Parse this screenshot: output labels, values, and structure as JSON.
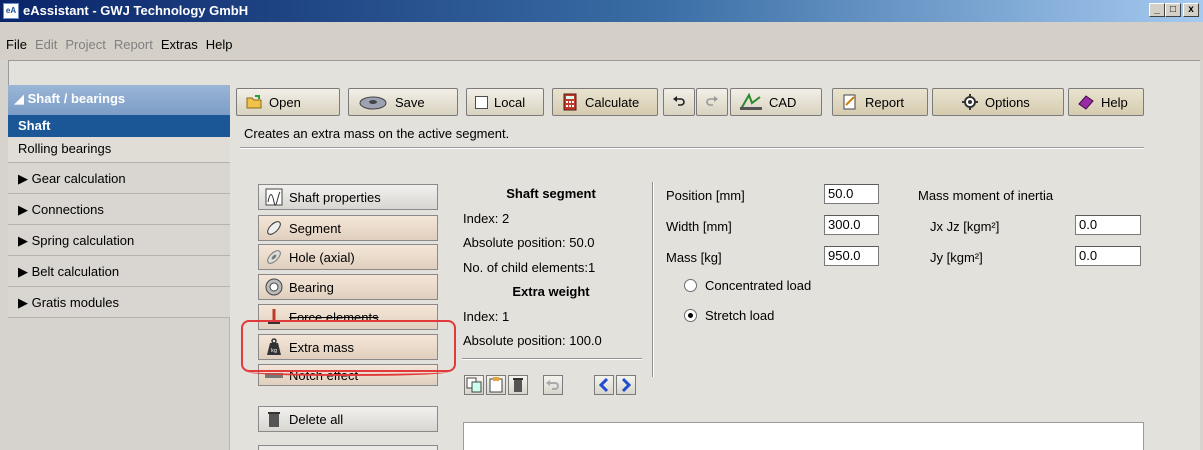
{
  "window": {
    "title": "eAssistant - GWJ Technology GmbH",
    "icon_text": "eA",
    "minimize": "_",
    "maximize": "□",
    "close": "x"
  },
  "menu": [
    "File",
    "Edit",
    "Project",
    "Report",
    "Extras",
    "Help"
  ],
  "sidebar": {
    "section": "◢ Shaft / bearings",
    "active": "Shaft",
    "sub": "Rolling bearings",
    "items": [
      "▶ Gear calculation",
      "▶ Connections",
      "▶ Spring calculation",
      "▶ Belt calculation",
      "▶ Gratis modules"
    ]
  },
  "toolbar": {
    "open": "Open",
    "save": "Save",
    "local": "Local",
    "calculate": "Calculate",
    "cad": "CAD",
    "report": "Report",
    "options": "Options",
    "help": "Help"
  },
  "status_text": "Creates an extra mass on the active segment.",
  "elements": {
    "shaft_properties": "Shaft properties",
    "segment": "Segment",
    "hole_axial": "Hole (axial)",
    "bearing": "Bearing",
    "force_elements": "Force elements",
    "extra_mass": "Extra mass",
    "notch_effect": "Notch effect",
    "delete_all": "Delete all"
  },
  "shaft_segment": {
    "heading": "Shaft segment",
    "index": "Index: 2",
    "abs_position": "Absolute position:  50.0",
    "child_elements": "No. of child elements:1"
  },
  "extra_weight": {
    "heading": "Extra weight",
    "index": "Index: 1",
    "abs_position": "Absolute position:  100.0"
  },
  "fields": {
    "position_label": "Position [mm]",
    "position_value": "50.0",
    "width_label": "Width [mm]",
    "width_value": "300.0",
    "mass_label": "Mass [kg]",
    "mass_value": "950.0",
    "moi_label": "Mass moment of inertia",
    "jxjz_label": "Jx Jz [kgm²]",
    "jxjz_value": "0.0",
    "jy_label": "Jy [kgm²]",
    "jy_value": "0.0",
    "concentrated": "Concentrated load",
    "stretch": "Stretch load"
  }
}
